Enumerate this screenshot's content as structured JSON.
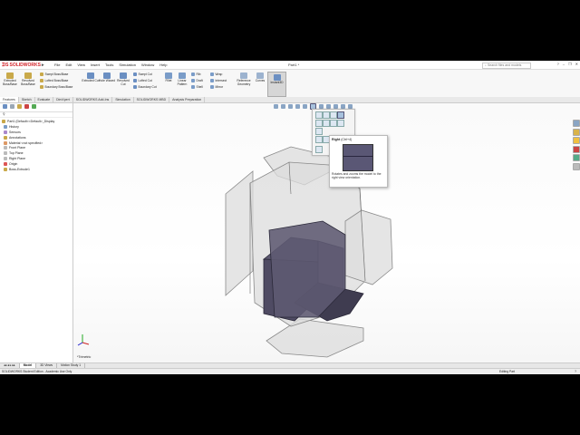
{
  "app": {
    "brand": "SOLIDWORKS",
    "window_title": "Part1 *"
  },
  "menu": [
    "File",
    "Edit",
    "View",
    "Insert",
    "Tools",
    "Simulation",
    "Window",
    "Help"
  ],
  "search": {
    "placeholder": "Search files and models"
  },
  "toolbar": {
    "extruded_boss": "Extruded Boss/Base",
    "revolved_boss": "Revolved Boss/Base",
    "swept_boss": "Swept Boss/Base",
    "lofted_boss": "Lofted Boss/Base",
    "boundary_boss": "Boundary Boss/Base",
    "extruded_cut": "Extruded Cut",
    "hole_wizard": "Hole Wizard",
    "revolved_cut": "Revolved Cut",
    "swept_cut": "Swept Cut",
    "lofted_cut": "Lofted Cut",
    "boundary_cut": "Boundary Cut",
    "fillet": "Fillet",
    "linear_pattern": "Linear Pattern",
    "rib": "Rib",
    "draft": "Draft",
    "shell": "Shell",
    "wrap": "Wrap",
    "intersect": "Intersect",
    "mirror": "Mirror",
    "reference_geometry": "Reference Geometry",
    "curves": "Curves",
    "instant3d": "Instant3D"
  },
  "tabs": [
    "Features",
    "Sketch",
    "Evaluate",
    "DimXpert",
    "SOLIDWORKS Add-Ins",
    "Simulation",
    "SOLIDWORKS MBD",
    "Analysis Preparation"
  ],
  "tree": [
    "Part1 (Default<<Default>_Display",
    "History",
    "Sensors",
    "Annotations",
    "Material <not specified>",
    "Front Plane",
    "Top Plane",
    "Right Plane",
    "Origin",
    "Boss-Extrude1"
  ],
  "tooltip": {
    "title": "Right",
    "shortcut": "(Ctrl+4)",
    "description": "Rotates and zooms the model to the right view orientation."
  },
  "viewport": {
    "view_name": "*Trimetric"
  },
  "bottom_tabs": [
    "Model",
    "3D Views",
    "Motion Study 1"
  ],
  "status": {
    "left": "SOLIDWORKS Student Edition - Academic Use Only",
    "right": "Editing Part"
  },
  "colors": {
    "brand": "#d2232a",
    "part": "#5c5870",
    "ghost": "#d9d9d9"
  }
}
